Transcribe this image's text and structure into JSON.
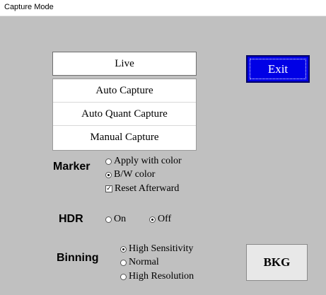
{
  "window": {
    "title": "Capture Mode"
  },
  "buttons": {
    "live": "Live",
    "auto_capture": "Auto Capture",
    "auto_quant_capture": "Auto Quant Capture",
    "manual_capture": "Manual Capture",
    "exit": "Exit",
    "bkg": "BKG"
  },
  "marker": {
    "label": "Marker",
    "options": [
      {
        "label": "Apply with color",
        "selected": false
      },
      {
        "label": "B/W color",
        "selected": true
      }
    ],
    "reset_afterward": {
      "label": "Reset Afterward",
      "checked": true
    }
  },
  "hdr": {
    "label": "HDR",
    "options": [
      {
        "label": "On",
        "selected": false
      },
      {
        "label": "Off",
        "selected": true
      }
    ]
  },
  "binning": {
    "label": "Binning",
    "options": [
      {
        "label": "High Sensitivity",
        "selected": true
      },
      {
        "label": "Normal",
        "selected": false
      },
      {
        "label": "High Resolution",
        "selected": false
      }
    ]
  },
  "colors": {
    "exit_bg": "#0000e6",
    "client_bg": "#c0c0c0"
  }
}
